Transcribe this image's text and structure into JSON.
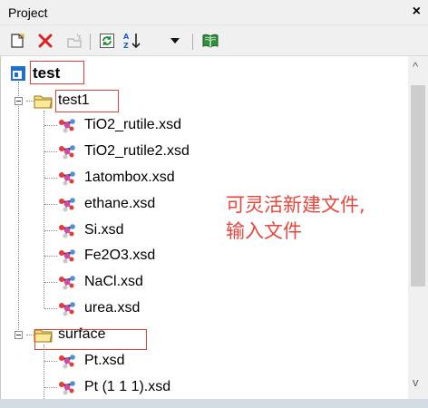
{
  "panel": {
    "title": "Project",
    "close_glyph": "×"
  },
  "toolbar": {
    "buttons": [
      {
        "name": "new-document-icon"
      },
      {
        "name": "delete-icon"
      },
      {
        "name": "new-folder-icon"
      },
      {
        "name": "refresh-icon"
      },
      {
        "name": "sort-az-icon"
      },
      {
        "name": "dropdown-arrow-icon"
      },
      {
        "name": "open-book-icon"
      }
    ]
  },
  "tree": {
    "root": {
      "label": "test"
    },
    "folder1": {
      "label": "test1",
      "children": [
        {
          "label": "TiO2_rutile.xsd"
        },
        {
          "label": "TiO2_rutile2.xsd"
        },
        {
          "label": "1atombox.xsd"
        },
        {
          "label": "ethane.xsd"
        },
        {
          "label": "Si.xsd"
        },
        {
          "label": "Fe2O3.xsd"
        },
        {
          "label": "NaCl.xsd"
        },
        {
          "label": "urea.xsd"
        }
      ]
    },
    "folder2": {
      "label": "surface",
      "children": [
        {
          "label": "Pt.xsd"
        },
        {
          "label": "Pt (1 1 1).xsd"
        }
      ]
    }
  },
  "annotation": {
    "line1": "可灵活新建文件,",
    "line2": "输入文件"
  },
  "scrollbar": {
    "up": "^",
    "down": "v"
  },
  "colors": {
    "annotation": "#e8463a",
    "highlight_box": "#e0453a"
  }
}
